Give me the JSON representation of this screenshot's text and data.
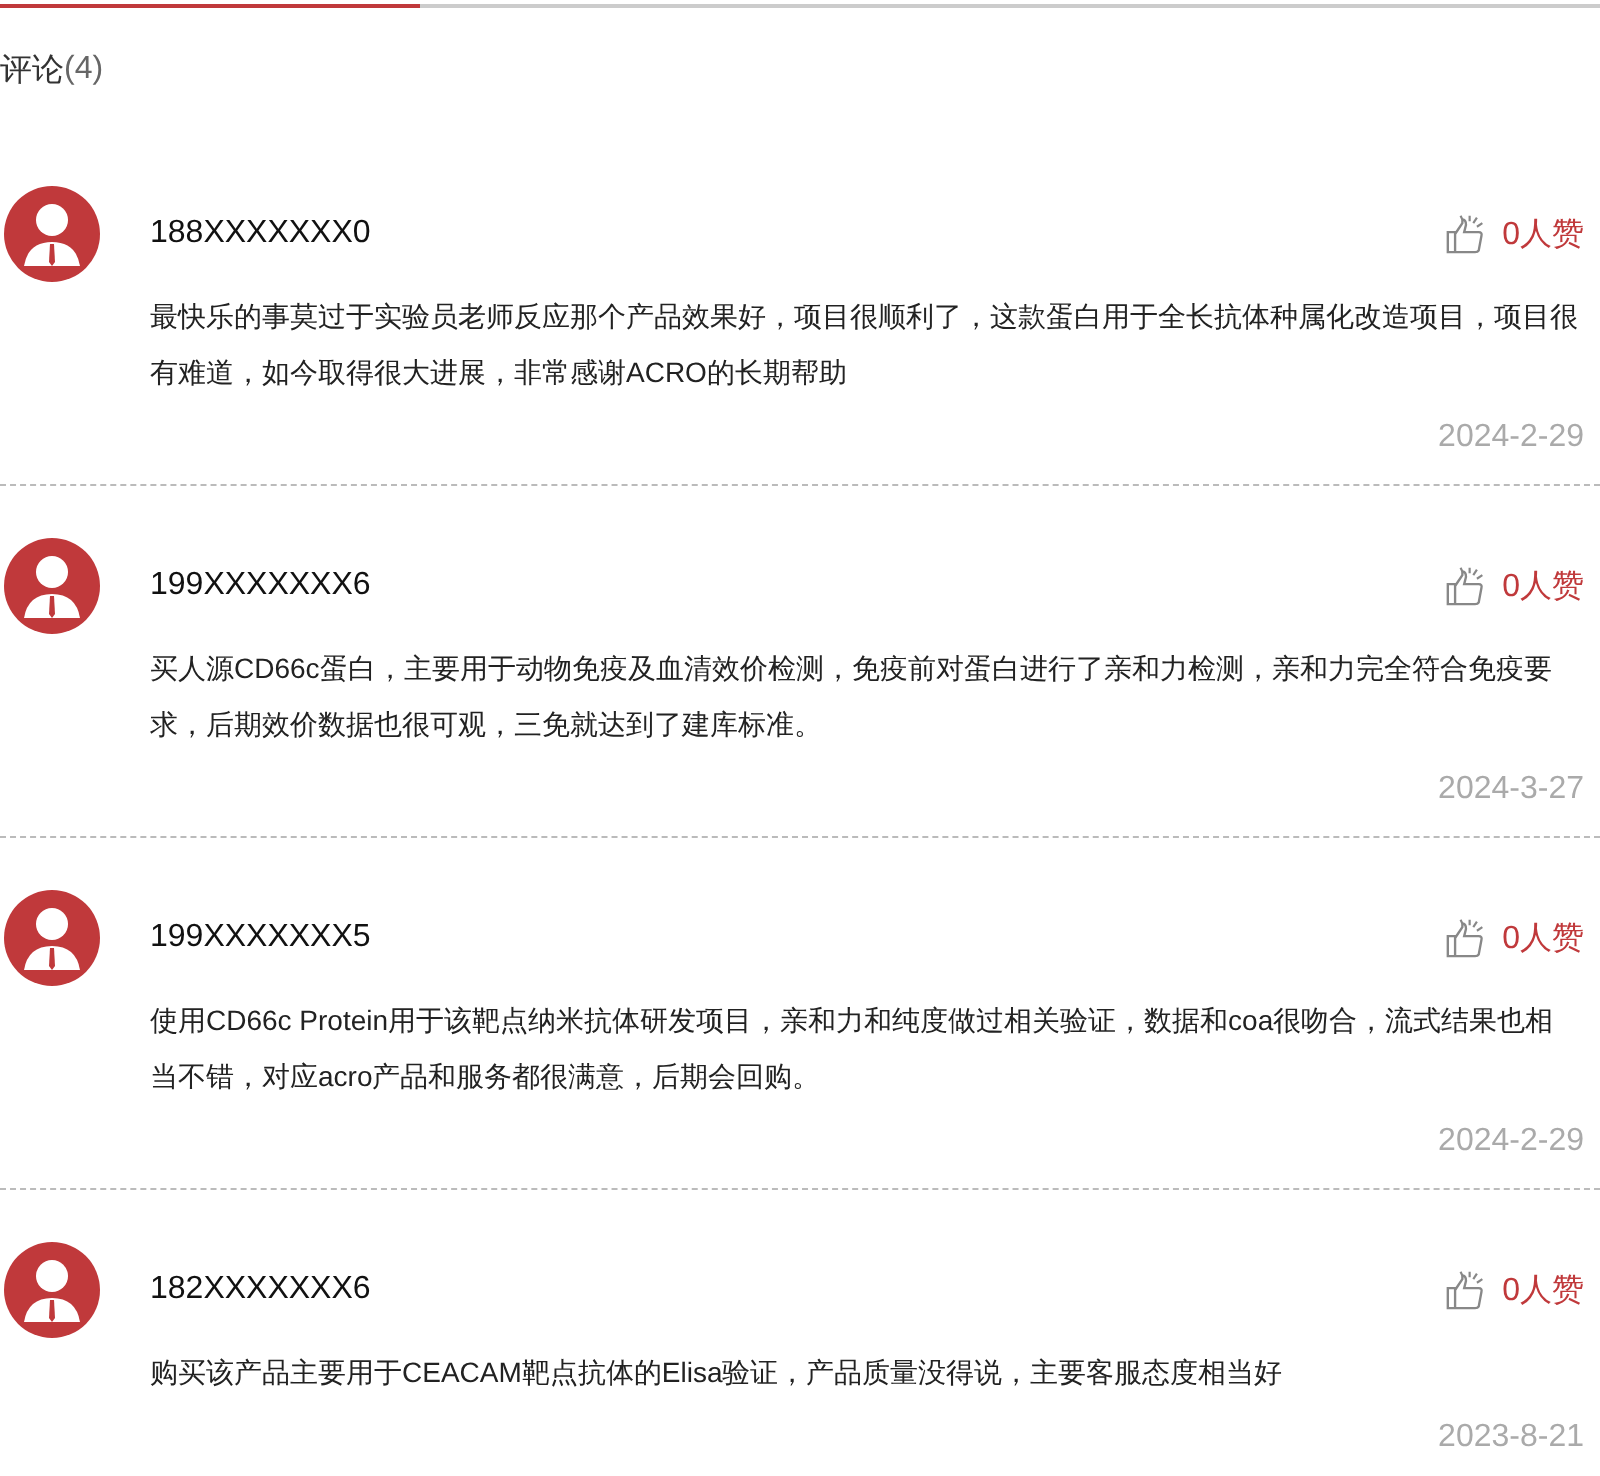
{
  "header": {
    "title": "评论",
    "count": "(4)"
  },
  "comments": [
    {
      "user": "188XXXXXXX0",
      "likes": "0人赞",
      "text": "最快乐的事莫过于实验员老师反应那个产品效果好，项目很顺利了，这款蛋白用于全长抗体种属化改造项目，项目很有难道，如今取得很大进展，非常感谢ACRO的长期帮助",
      "date": "2024-2-29"
    },
    {
      "user": "199XXXXXXX6",
      "likes": "0人赞",
      "text": "买人源CD66c蛋白，主要用于动物免疫及血清效价检测，免疫前对蛋白进行了亲和力检测，亲和力完全符合免疫要求，后期效价数据也很可观，三免就达到了建库标准。",
      "date": "2024-3-27"
    },
    {
      "user": "199XXXXXXX5",
      "likes": "0人赞",
      "text": "使用CD66c Protein用于该靶点纳米抗体研发项目，亲和力和纯度做过相关验证，数据和coa很吻合，流式结果也相当不错，对应acro产品和服务都很满意，后期会回购。",
      "date": "2024-2-29"
    },
    {
      "user": "182XXXXXXX6",
      "likes": "0人赞",
      "text": "购买该产品主要用于CEACAM靶点抗体的Elisa验证，产品质量没得说，主要客服态度相当好",
      "date": "2023-8-21"
    }
  ]
}
